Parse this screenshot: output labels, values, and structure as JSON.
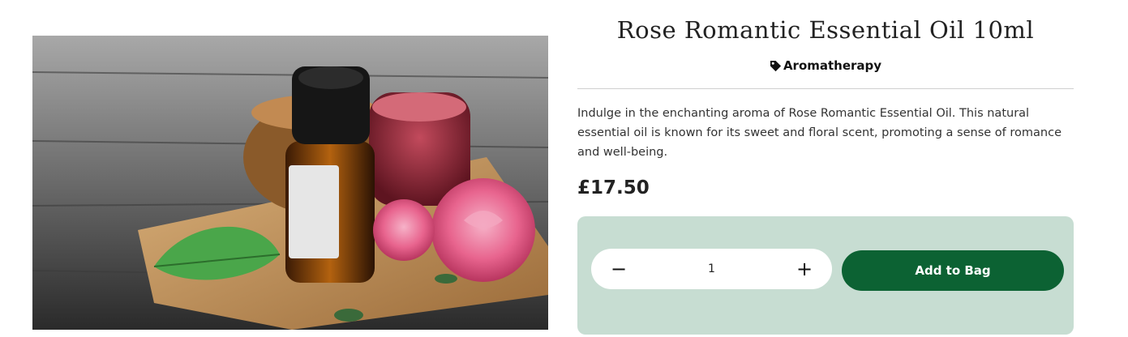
{
  "product": {
    "title": "Rose Romantic Essential Oil 10ml",
    "category": "Aromatherapy",
    "description": "Indulge in the enchanting aroma of Rose Romantic Essential Oil. This natural essential oil is known for its sweet and floral scent, promoting a sense of romance and well-being.",
    "price": "£17.50",
    "image_icon": "product-photo"
  },
  "purchase": {
    "decrement_label": "−",
    "quantity_value": "1",
    "increment_label": "+",
    "add_to_bag_label": "Add to Bag"
  },
  "colors": {
    "panel_bg": "#c7ddd2",
    "button_bg": "#0c6233",
    "button_text": "#ffffff",
    "divider": "#cfcfcf"
  },
  "icons": {
    "category": "tag-icon",
    "decrement": "minus-icon",
    "increment": "plus-icon"
  }
}
